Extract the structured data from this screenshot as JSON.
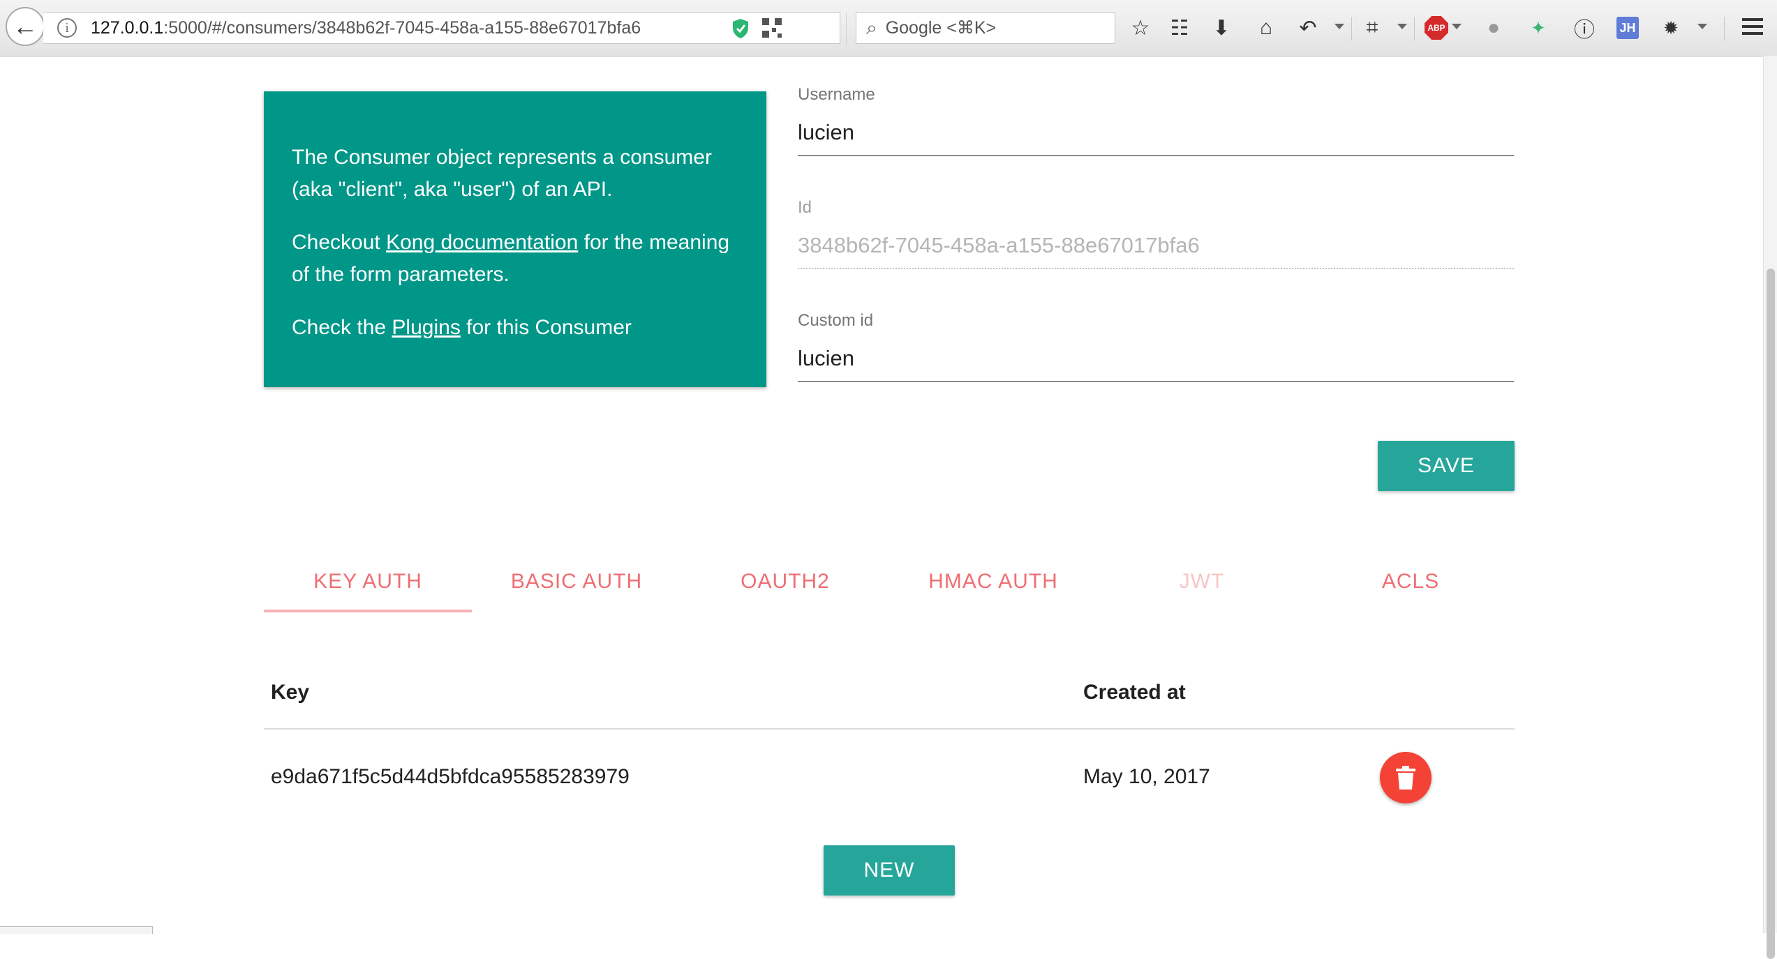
{
  "browser": {
    "url_host": "127.0.0.1",
    "url_rest": ":5000/#/consumers/3848b62f-7045-458a-a155-88e67017bfa6",
    "search_placeholder": "Google <⌘K>",
    "abp_label": "ABP",
    "jh_label": "JH"
  },
  "info_card": {
    "para1": "The Consumer object represents a consumer (aka \"client\", aka \"user\") of an API.",
    "para2_before": "Checkout ",
    "para2_link": "Kong documentation",
    "para2_after": " for the meaning of the form parameters.",
    "para3_before": "Check the ",
    "para3_link": "Plugins",
    "para3_after": " for this Consumer"
  },
  "form": {
    "username_label": "Username",
    "username_value": "lucien",
    "id_label": "Id",
    "id_value": "3848b62f-7045-458a-a155-88e67017bfa6",
    "custom_id_label": "Custom id",
    "custom_id_value": "lucien",
    "save_label": "SAVE"
  },
  "tabs": [
    {
      "label": "KEY AUTH",
      "active": true
    },
    {
      "label": "BASIC AUTH"
    },
    {
      "label": "OAUTH2"
    },
    {
      "label": "HMAC AUTH"
    },
    {
      "label": "JWT",
      "disabled": true
    },
    {
      "label": "ACLS"
    }
  ],
  "table": {
    "headers": [
      "Key",
      "Created at"
    ],
    "rows": [
      {
        "key": "e9da671f5c5d44d5bfdca95585283979",
        "created_at": "May 10, 2017"
      }
    ]
  },
  "new_label": "NEW",
  "colors": {
    "card": "#009688",
    "button": "#26a69a",
    "tab_text": "#ee6e73",
    "delete": "#f44336"
  }
}
